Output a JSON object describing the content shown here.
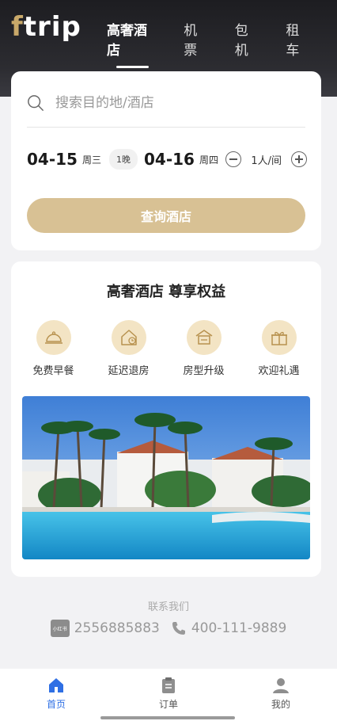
{
  "header": {
    "logo_f": "f",
    "logo_rest": "trip",
    "nav": [
      "高奢酒店",
      "机票",
      "包机",
      "租车"
    ]
  },
  "search": {
    "placeholder": "搜索目的地/酒店",
    "checkin_date": "04-15",
    "checkin_weekday": "周三",
    "nights": "1晚",
    "checkout_date": "04-16",
    "checkout_weekday": "周四",
    "guests": "1人/间",
    "button": "查询酒店"
  },
  "benefits": {
    "title": "高奢酒店 尊享权益",
    "items": [
      {
        "label": "免费早餐",
        "icon": "dining-cloche-icon"
      },
      {
        "label": "延迟退房",
        "icon": "house-clock-icon"
      },
      {
        "label": "房型升级",
        "icon": "room-upgrade-icon"
      },
      {
        "label": "欢迎礼遇",
        "icon": "gift-icon"
      }
    ]
  },
  "contact": {
    "title": "联系我们",
    "redbook_label": "小红书",
    "redbook_id": "2556885883",
    "phone": "400-111-9889"
  },
  "tabbar": [
    {
      "label": "首页",
      "icon": "home-icon",
      "active": true
    },
    {
      "label": "订单",
      "icon": "clipboard-icon",
      "active": false
    },
    {
      "label": "我的",
      "icon": "user-icon",
      "active": false
    }
  ],
  "colors": {
    "accent_gold": "#d8c194",
    "active_blue": "#2f6fe4",
    "header_dark": "#1d1d21"
  }
}
